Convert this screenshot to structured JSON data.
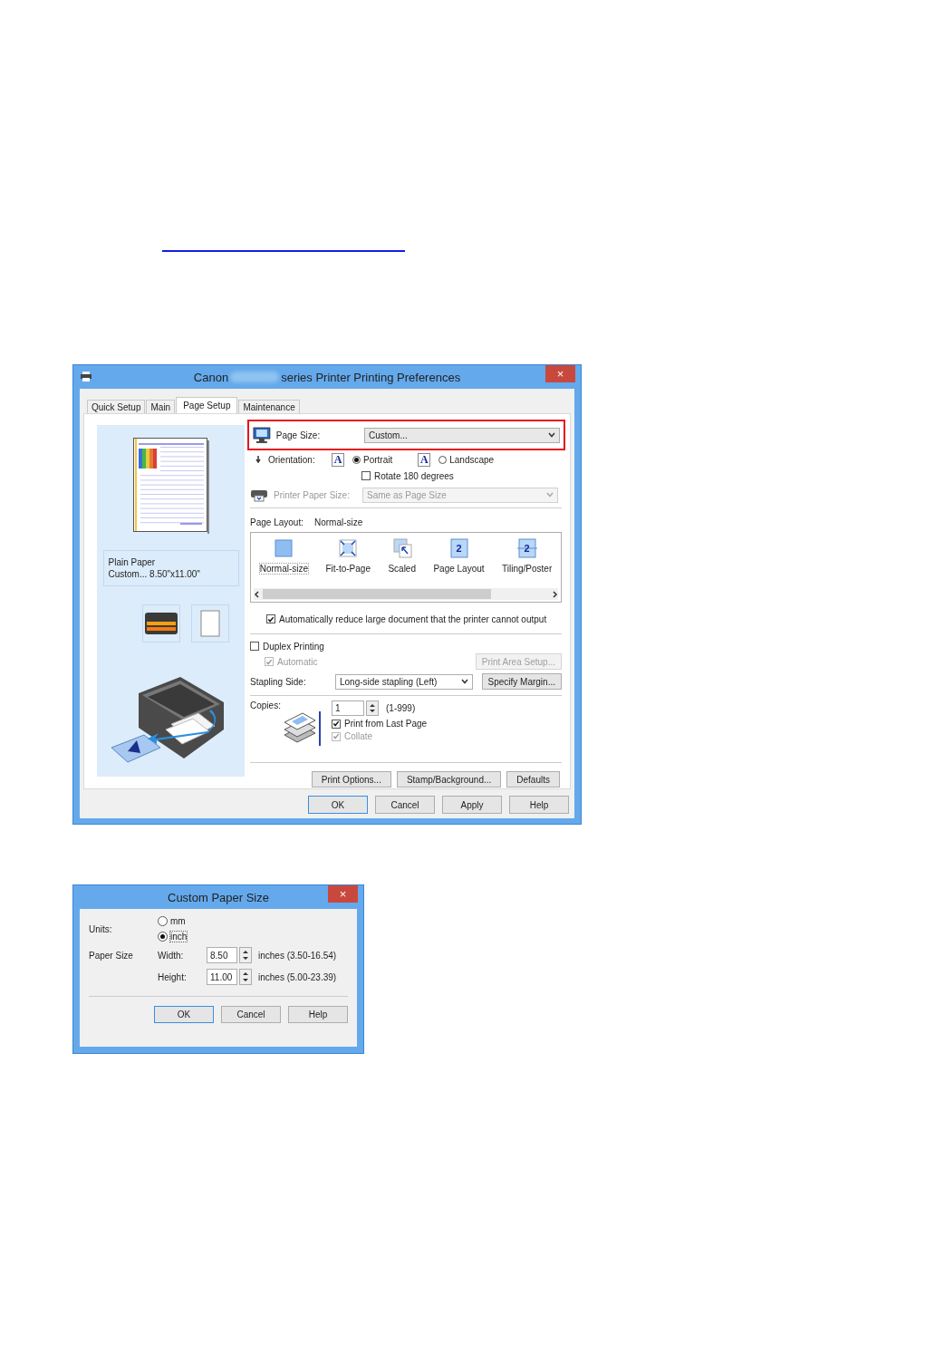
{
  "printer_dialog": {
    "title": {
      "brand": "Canon",
      "rest": "series Printer Printing Preferences"
    },
    "close_glyph": "×",
    "tabs": [
      {
        "label": "Quick Setup",
        "selected": false
      },
      {
        "label": "Main",
        "selected": false
      },
      {
        "label": "Page Setup",
        "selected": true
      },
      {
        "label": "Maintenance",
        "selected": false
      }
    ],
    "preview": {
      "media": "Plain Paper",
      "size": "Custom... 8.50\"x11.00\""
    },
    "page_size": {
      "label": "Page Size:",
      "value": "Custom...",
      "highlighted": true
    },
    "orientation": {
      "label": "Orientation:",
      "options": [
        {
          "label": "Portrait",
          "glyph": "A",
          "selected": true
        },
        {
          "label": "Landscape",
          "glyph": "A",
          "selected": false
        }
      ]
    },
    "rotate": {
      "label": "Rotate 180 degrees",
      "checked": false
    },
    "printer_paper_size": {
      "label": "Printer Paper Size:",
      "value": "Same as Page Size",
      "disabled": true
    },
    "page_layout": {
      "label": "Page Layout:",
      "value": "Normal-size",
      "options": [
        {
          "label": "Normal-size",
          "kind": "normal",
          "selected": true
        },
        {
          "label": "Fit-to-Page",
          "kind": "fit",
          "selected": false
        },
        {
          "label": "Scaled",
          "kind": "scaled",
          "selected": false
        },
        {
          "label": "Page Layout",
          "kind": "layout",
          "glyph": "2",
          "selected": false
        },
        {
          "label": "Tiling/Poster",
          "kind": "tiling",
          "glyph": "2",
          "selected": false
        }
      ]
    },
    "auto_reduce": {
      "label": "Automatically reduce large document that the printer cannot output",
      "checked": true
    },
    "duplex": {
      "label": "Duplex Printing",
      "checked": false
    },
    "automatic": {
      "label": "Automatic",
      "checked": true,
      "disabled": true
    },
    "print_area_button": {
      "label": "Print Area Setup...",
      "disabled": true
    },
    "stapling": {
      "label": "Stapling Side:",
      "value": "Long-side stapling (Left)"
    },
    "specify_margin_button": {
      "label": "Specify Margin...",
      "disabled": false
    },
    "copies": {
      "label": "Copies:",
      "value": "1",
      "range": "(1-999)"
    },
    "print_from_last": {
      "label": "Print from Last Page",
      "checked": true,
      "disabled": false
    },
    "collate": {
      "label": "Collate",
      "checked": true,
      "disabled": true
    },
    "option_buttons": [
      "Print Options...",
      "Stamp/Background...",
      "Defaults"
    ],
    "buttons": [
      {
        "label": "OK",
        "default": true
      },
      {
        "label": "Cancel",
        "default": false
      },
      {
        "label": "Apply",
        "default": false
      },
      {
        "label": "Help",
        "default": false
      }
    ]
  },
  "custom_dialog": {
    "title": "Custom Paper Size",
    "close_glyph": "×",
    "units_label": "Units:",
    "units": [
      {
        "label": "mm",
        "selected": false
      },
      {
        "label": "inch",
        "selected": true
      }
    ],
    "paper_size_label": "Paper Size",
    "fields": [
      {
        "label": "Width:",
        "value": "8.50",
        "range": "inches (3.50-16.54)"
      },
      {
        "label": "Height:",
        "value": "11.00",
        "range": "inches (5.00-23.39)"
      }
    ],
    "buttons": [
      {
        "label": "OK",
        "default": true
      },
      {
        "label": "Cancel",
        "default": false
      },
      {
        "label": "Help",
        "default": false
      }
    ]
  }
}
